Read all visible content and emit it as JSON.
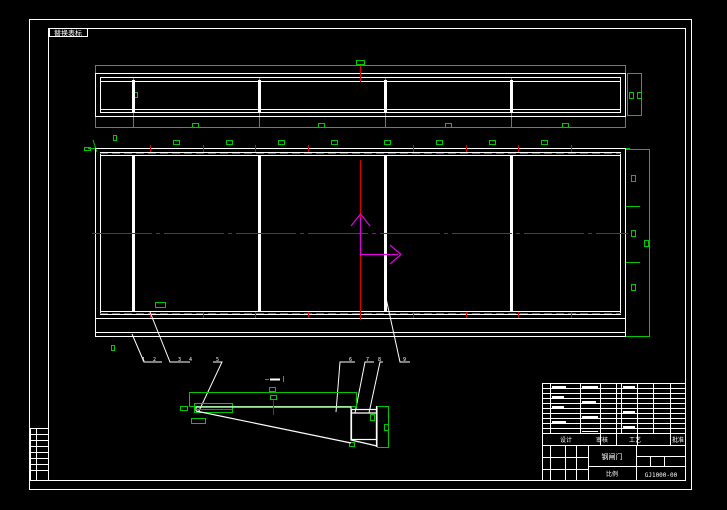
{
  "sheet": {
    "code_label": "替换表标",
    "colors": {
      "background": "#000000",
      "outline": "#ffffff",
      "dimension": "#00c800",
      "centerline": "#e00000",
      "section": "#e000e0",
      "cut": "#b400b4"
    }
  },
  "callouts": {
    "leaders_left": [
      "1",
      "2",
      "3",
      "4",
      "5"
    ],
    "leaders_right": [
      "6",
      "7",
      "8",
      "9"
    ]
  },
  "title_block": {
    "cell_a": "设计",
    "cell_b": "审核",
    "cell_c": "工艺",
    "cell_d": "批准",
    "drawing_name": "钢闸门",
    "scale": "比例",
    "drawing_no": "GJ1000-00"
  }
}
